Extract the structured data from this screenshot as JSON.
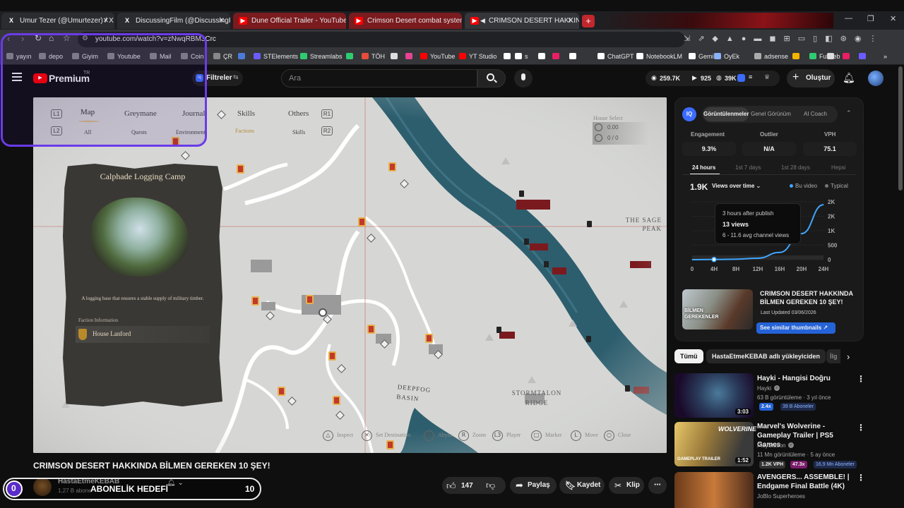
{
  "browser": {
    "tabs": [
      {
        "title": "Umur Tezer (@Umurtezer) / X",
        "icon": "x-logo-icon"
      },
      {
        "title": "DiscussingFilm (@DiscussingFilm) / X",
        "icon": "x-logo-icon"
      },
      {
        "title": "Dune Official Trailer - YouTube",
        "icon": "youtube-icon"
      },
      {
        "title": "Crimson Desert combat system is n",
        "icon": "youtube-icon"
      },
      {
        "title": "CRIMSON DESERT HAKKINDA",
        "icon": "youtube-icon",
        "active": true
      }
    ],
    "url": "youtube.com/watch?v=zNwqRBM3Crc",
    "bookmarks": [
      "yayın",
      "depo",
      "Giyim",
      "Youtube",
      "Mail",
      "Coin",
      "ÇR",
      "STElements",
      "Streamlabs",
      "TÖH",
      "YouTube",
      "YT Studio",
      "s",
      "ChatGPT",
      "NotebookLM",
      "Gemini",
      "OyEk",
      "adsense",
      "Futweb"
    ]
  },
  "yt": {
    "brand": "Premium",
    "country": "TR",
    "filters_label": "Filtreler",
    "search_placeholder": "Ara",
    "stats": {
      "views": "259.7K",
      "videos": "925",
      "subs": "39K"
    },
    "create_label": "Oluştur"
  },
  "game": {
    "tabs": [
      "Map",
      "Greymane",
      "Journal",
      "Skills",
      "Others"
    ],
    "subtabs": [
      "All",
      "Quests",
      "Environment",
      "Factions",
      "Skills"
    ],
    "btn_l1": "L1",
    "btn_r1": "R1",
    "btn_l2": "L2",
    "btn_r2": "R2",
    "house_select": "House Select",
    "counter1": "0.00",
    "counter2": "0 / 0",
    "card_title": "Calphade Logging Camp",
    "card_desc": "A logging base that ensures a stable supply of military timber.",
    "faction_heading": "Faction Information",
    "faction_name": "House Lanford",
    "labels": {
      "sage": "THE SAGE PEAK",
      "deepfog": "DEEPFOG BASIN",
      "stormtalon": "STORMTALON RIDGE"
    },
    "controls": [
      {
        "btn": "△",
        "label": "Inspect"
      },
      {
        "btn": "✕",
        "label": "Set Destination"
      },
      {
        "btn": "R3",
        "label": "Abyss"
      },
      {
        "btn": "R",
        "label": "Zoom"
      },
      {
        "btn": "L3",
        "label": "Player"
      },
      {
        "btn": "□",
        "label": "Marker"
      },
      {
        "btn": "L",
        "label": "Move"
      },
      {
        "btn": "○",
        "label": "Close"
      }
    ]
  },
  "video": {
    "title": "CRIMSON DESERT HAKKINDA BİLMEN GEREKEN 10 ŞEY!",
    "channel": "HastaEtmeKEBAB",
    "subs": "1,27 B abone",
    "likes": "147",
    "share": "Paylaş",
    "save": "Kaydet",
    "clip": "Klip"
  },
  "sub_goal": {
    "current": "0",
    "label": "ABONELİK HEDEFİ",
    "target": "10",
    "fill_fraction": 0.0
  },
  "vidiq": {
    "tabs": [
      "Görüntülenmeler",
      "Genel Görünüm",
      "AI Coach"
    ],
    "metrics": [
      {
        "label": "Engagement",
        "value": "9.3%"
      },
      {
        "label": "Outlier",
        "value": "N/A"
      },
      {
        "label": "VPH",
        "value": "75.1"
      }
    ],
    "ranges": [
      "24 hours",
      "1st 7 days",
      "1st 28 days",
      "Hepsi"
    ],
    "views_value": "1.9K",
    "views_mode": "Views over time",
    "legend_this": "Bu video",
    "legend_typical": "Typical",
    "tooltip": {
      "line1": "3 hours after publish",
      "line2": "13 views",
      "line3": "6 - 11.6 avg channel views"
    },
    "thumb_title": "CRIMSON DESERT HAKKINDA BİLMEN GEREKEN 10 ŞEY!",
    "thumb_updated": "Last Updated 03/06/2026",
    "thumb_button": "See similar thumbnails",
    "thumb_caption": "BİLMEN GEREKENLER"
  },
  "chart_data": {
    "type": "line",
    "x": [
      "0",
      "4H",
      "8H",
      "12H",
      "16H",
      "20H",
      "24H"
    ],
    "y_ticks": [
      "0",
      "500",
      "1K",
      "2K",
      "2K"
    ],
    "series": [
      {
        "name": "Bu video",
        "values": [
          0,
          5,
          15,
          50,
          250,
          900,
          1900
        ]
      }
    ]
  },
  "related": {
    "chips": [
      "Tümü",
      "HastaEtmeKEBAB adlı yükleyiciden",
      "İlg"
    ],
    "videos": [
      {
        "title": "Hayki - Hangisi Doğru",
        "channel": "Hayki",
        "meta": "63 B görüntüleme · 3 yıl önce",
        "badge1": "2.4x",
        "badge2": "39 B Aboneler",
        "duration": "3:03"
      },
      {
        "title": "Marvel's Wolverine - Gameplay Trailer | PS5 Games",
        "channel": "PlayStation",
        "meta": "11 Mn görüntüleme · 5 ay önce",
        "badge1": "1.2K VPH",
        "badge2": "47.3x",
        "badge3": "16,9 Mn Aboneler",
        "duration": "1:52"
      },
      {
        "title": "AVENGERS... ASSEMBLE! | Endgame Final Battle (4K)",
        "channel": "JoBlo Superheroes",
        "meta": "",
        "badge1": "",
        "badge2": "",
        "duration": ""
      }
    ]
  },
  "colors": {
    "accent": "#3ea6ff",
    "brand_red": "#ff0000",
    "vidiq_blue": "#3b6cff",
    "goal_purple": "#5b2bc9",
    "outline_purple": "#6a3be8"
  }
}
